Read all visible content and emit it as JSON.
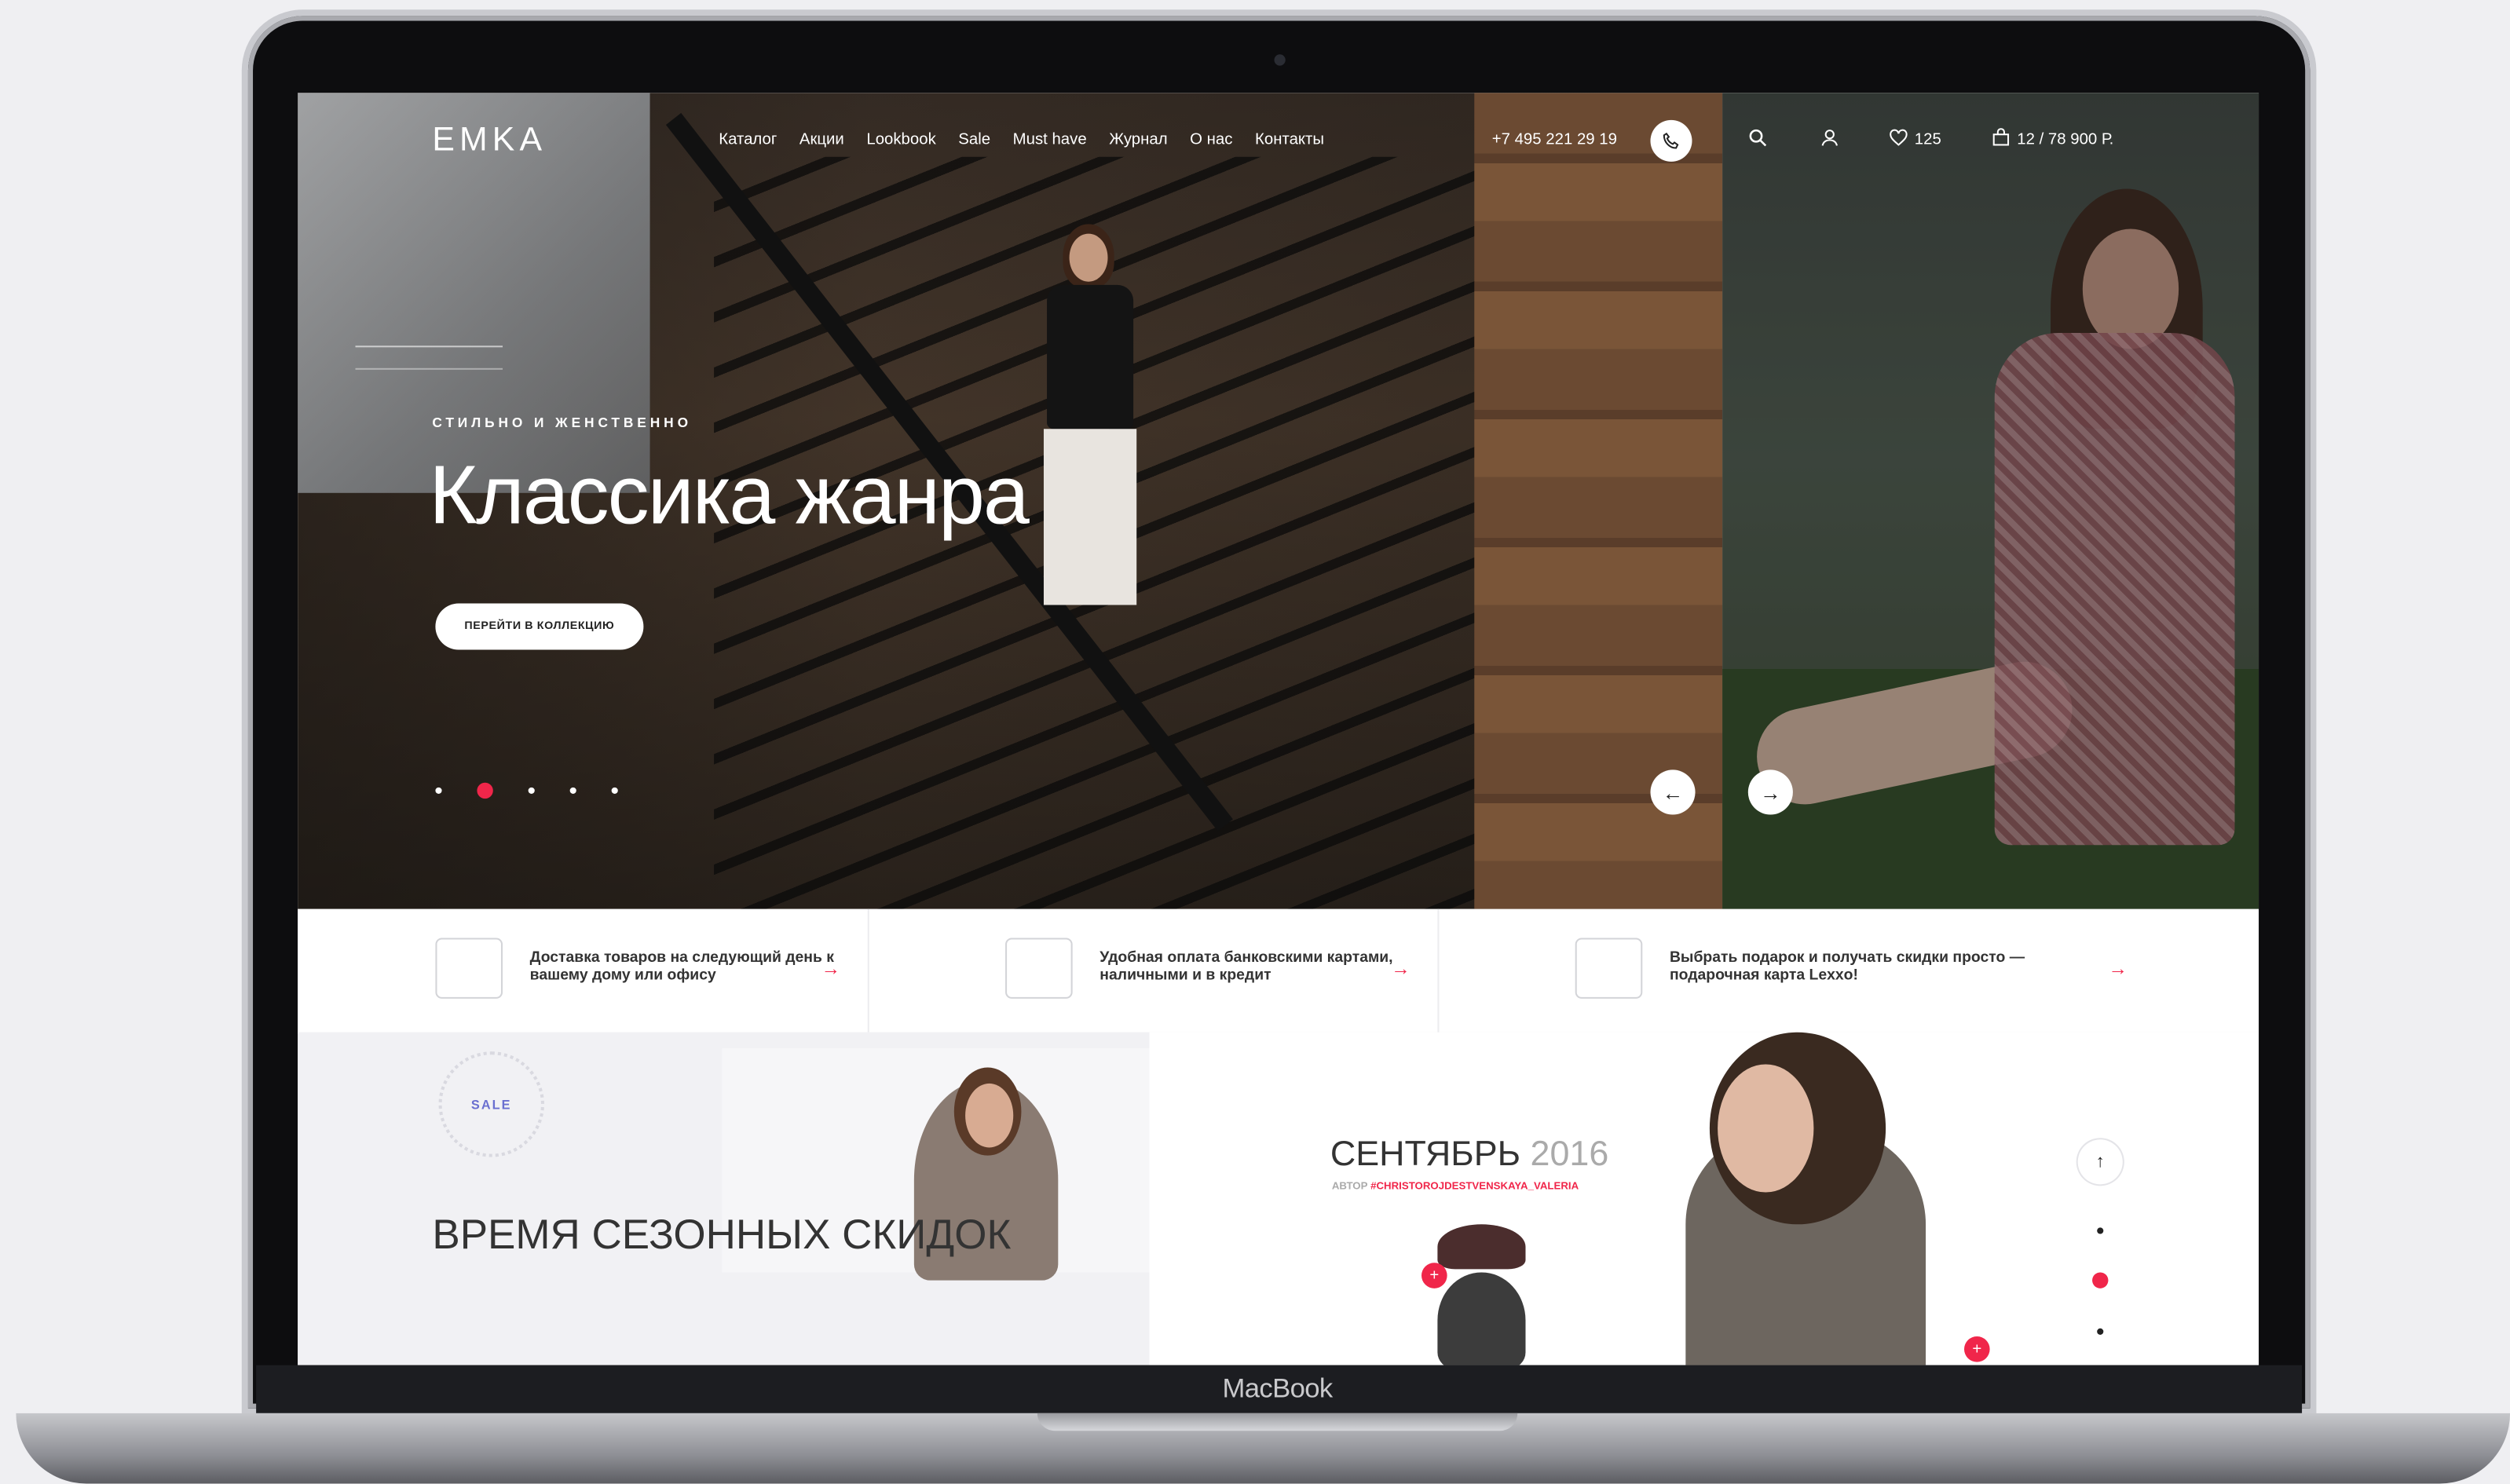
{
  "device": {
    "label": "MacBook"
  },
  "header": {
    "logo": "EMKA",
    "nav": [
      "Каталог",
      "Акции",
      "Lookbook",
      "Sale",
      "Must have",
      "Журнал",
      "О нас",
      "Контакты"
    ],
    "phone": "+7 495 221 29 19",
    "favorites_count": "125",
    "cart": "12 / 78 900 Р."
  },
  "hero": {
    "eyebrow": "СТИЛЬНО И ЖЕНСТВЕННО",
    "title": "Классика жанра",
    "cta": "ПЕРЕЙТИ В КОЛЛЕКЦИЮ",
    "slides_total": 5,
    "active_slide": 2,
    "prev_arrow": "←",
    "next_arrow": "→"
  },
  "features": [
    {
      "text": "Доставка товаров на следующий день к вашему дому или офису",
      "icon": "truck-icon"
    },
    {
      "text": "Удобная оплата банковскими картами, наличными и в кредит",
      "icon": "wallet-icon"
    },
    {
      "text": "Выбрать подарок и получать скидки просто — подарочная карта Lexxo!",
      "icon": "gift-icon"
    }
  ],
  "sale": {
    "badge": "SALE",
    "title": "ВРЕМЯ СЕЗОННЫХ СКИДОК"
  },
  "lookbook": {
    "month": "СЕНТЯБРЬ",
    "year": "2016",
    "author_label": "АВТОР",
    "author_tag": "#CHRISTOROJDESTVENSKAYA_VALERIA",
    "pin_label": "+"
  },
  "colors": {
    "accent": "#f0264a",
    "sale": "#6a6fd0"
  }
}
